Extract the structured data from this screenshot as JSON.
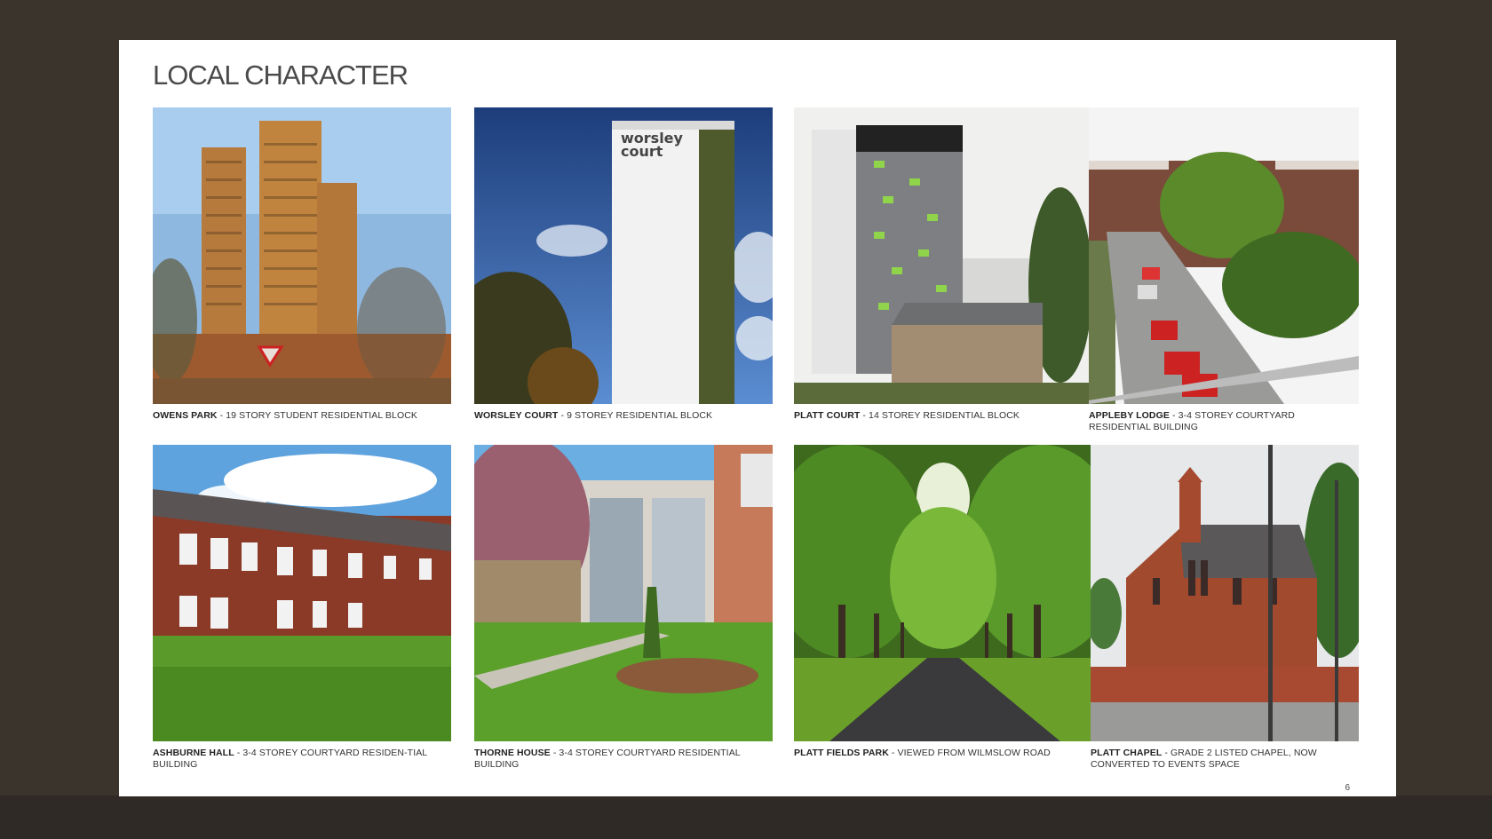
{
  "page": {
    "title": "LOCAL CHARACTER",
    "page_number": "6"
  },
  "photos": [
    {
      "name": "OWENS PARK",
      "desc": " - 19 STORY STUDENT RESIDENTIAL BLOCK",
      "sign_text": ""
    },
    {
      "name": "WORSLEY COURT",
      "desc": " - 9 STOREY RESIDENTIAL BLOCK",
      "sign_text_1": "worsley",
      "sign_text_2": "court"
    },
    {
      "name": "PLATT COURT",
      "desc": " - 14 STOREY RESIDENTIAL BLOCK"
    },
    {
      "name": "APPLEBY LODGE",
      "desc": " - 3-4 STOREY COURTYARD RESIDENTIAL BUILDING"
    },
    {
      "name": "ASHBURNE HALL",
      "desc": " - 3-4 STOREY COURTYARD RESIDEN-TIAL BUILDING"
    },
    {
      "name": "THORNE HOUSE",
      "desc": " - 3-4 STOREY COURTYARD RESIDENTIAL BUILDING"
    },
    {
      "name": "PLATT FIELDS PARK",
      "desc": " - VIEWED FROM WILMSLOW ROAD"
    },
    {
      "name": "PLATT CHAPEL",
      "desc": " - GRADE 2 LISTED CHAPEL, NOW CONVERTED TO EVENTS SPACE"
    }
  ]
}
